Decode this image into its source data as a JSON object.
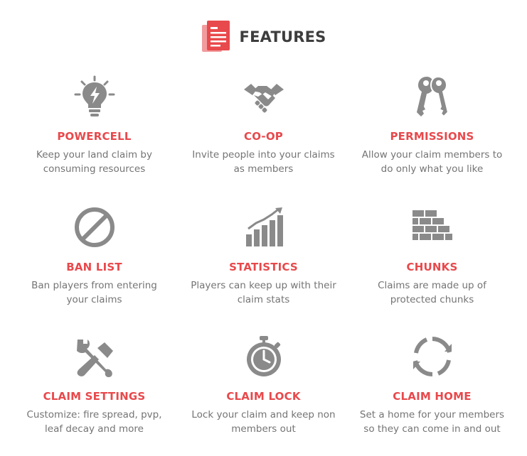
{
  "header": {
    "title": "FEATURES",
    "icon": "document-icon",
    "accent": "#e8494c"
  },
  "colors": {
    "icon": "#8a8a8a",
    "feature_title": "#e8494c",
    "description": "#747474",
    "heading": "#3d3d3d"
  },
  "features": [
    {
      "icon": "lightbulb-icon",
      "title": "POWERCELL",
      "description": "Keep your land claim by consuming resources"
    },
    {
      "icon": "handshake-icon",
      "title": "CO-OP",
      "description": "Invite people into your claims as members"
    },
    {
      "icon": "keys-icon",
      "title": "PERMISSIONS",
      "description": "Allow your claim members to do only what you like"
    },
    {
      "icon": "ban-icon",
      "title": "BAN LIST",
      "description": "Ban players from entering your claims"
    },
    {
      "icon": "bar-chart-icon",
      "title": "STATISTICS",
      "description": "Players can keep up with their claim stats"
    },
    {
      "icon": "brick-wall-icon",
      "title": "CHUNKS",
      "description": "Claims are made up of protected chunks"
    },
    {
      "icon": "tools-icon",
      "title": "CLAIM SETTINGS",
      "description": "Customize: fire spread, pvp, leaf decay and more"
    },
    {
      "icon": "stopwatch-icon",
      "title": "CLAIM LOCK",
      "description": "Lock your claim and keep non members out"
    },
    {
      "icon": "refresh-icon",
      "title": "CLAIM HOME",
      "description": "Set a home for your members so they can come in and out"
    }
  ]
}
